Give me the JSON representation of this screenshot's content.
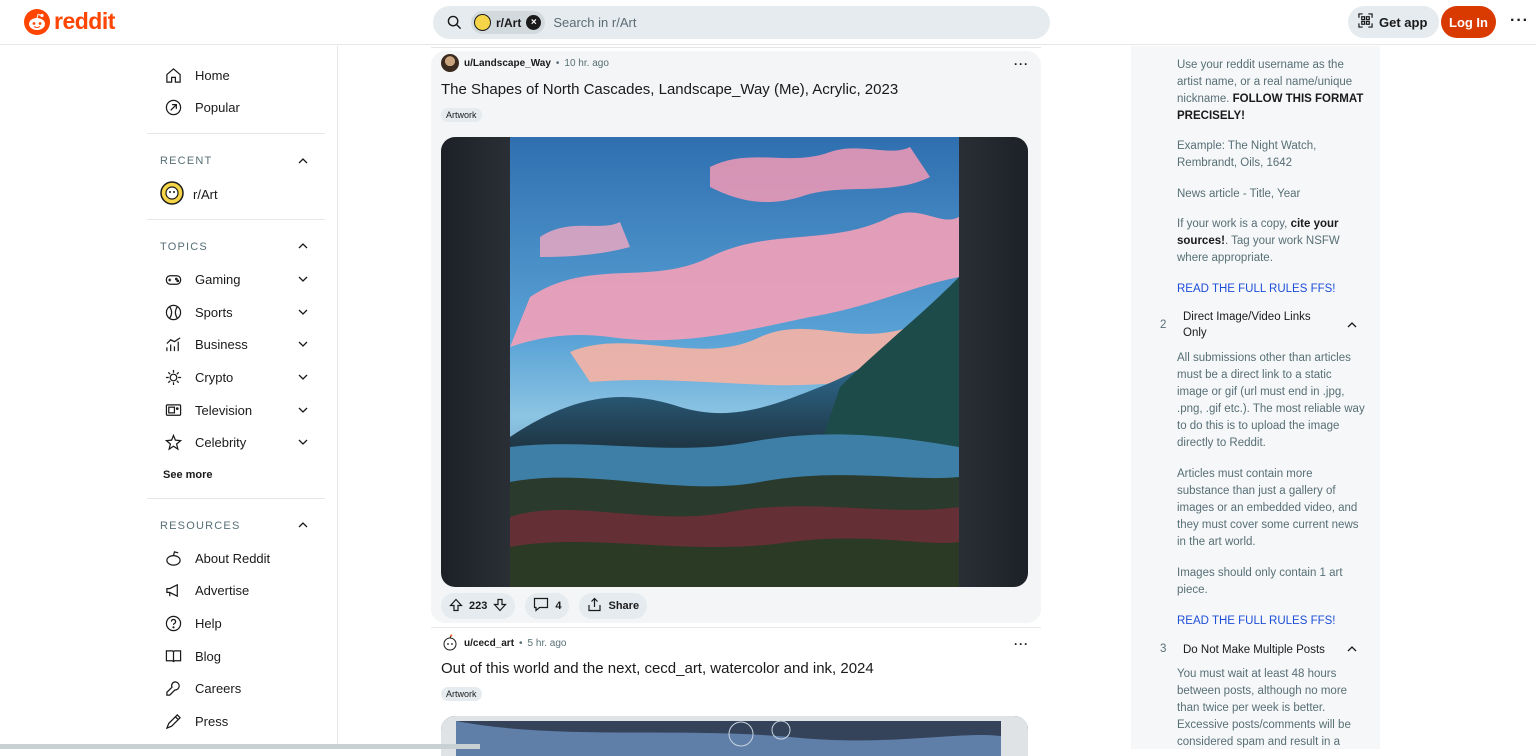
{
  "header": {
    "logo_text": "reddit",
    "search": {
      "community": "r/Art",
      "placeholder": "Search in r/Art"
    },
    "get_app_label": "Get app",
    "login_label": "Log In",
    "more_label": "···"
  },
  "sidebar": {
    "home": "Home",
    "popular": "Popular",
    "recent_title": "RECENT",
    "recent_item": "r/Art",
    "topics_title": "TOPICS",
    "topics": [
      "Gaming",
      "Sports",
      "Business",
      "Crypto",
      "Television",
      "Celebrity"
    ],
    "see_more": "See more",
    "resources_title": "RESOURCES",
    "resources": [
      "About Reddit",
      "Advertise",
      "Help",
      "Blog",
      "Careers",
      "Press"
    ]
  },
  "posts": [
    {
      "user": "u/Landscape_Way",
      "dot": "•",
      "time": "10 hr. ago",
      "title": "The Shapes of North Cascades, Landscape_Way (Me), Acrylic, 2023",
      "flair": "Artwork",
      "upvotes": "223",
      "comments": "4",
      "share": "Share",
      "more": "···"
    },
    {
      "user": "u/cecd_art",
      "dot": "•",
      "time": "5 hr. ago",
      "title": "Out of this world and the next, cecd_art, watercolor and ink, 2024",
      "flair": "Artwork",
      "more": "···"
    }
  ],
  "rules": {
    "p1_plain": "Use your reddit username as the artist name, or a real name/unique nickname.",
    "p1_bold": "FOLLOW THIS FORMAT PRECISELY!",
    "example": "Example: The Night Watch, Rembrandt, Oils, 1642",
    "news": "News article - Title, Year",
    "copy_a": "If your work is a copy,",
    "copy_bold": "cite your sources!",
    "copy_b": ". Tag your work NSFW where appropriate.",
    "read_link_1": "READ THE FULL RULES FFS!",
    "rule2_num": "2",
    "rule2_title": "Direct Image/Video Links Only",
    "rule2_p1": "All submissions other than articles must be a direct link to a static image or gif (url must end in .jpg, .png, .gif etc.). The most reliable way to do this is to upload the image directly to Reddit.",
    "rule2_p2": "Articles must contain more substance than just a gallery of images or an embedded video, and they must cover some current news in the art world.",
    "rule2_p3": "Images should only contain 1 art piece.",
    "read_link_2": "READ THE FULL RULES FFS!",
    "rule3_num": "3",
    "rule3_title": "Do Not Make Multiple Posts",
    "rule3_p1": "You must wait at least 48 hours between posts, although no more than twice per week is better. Excessive posts/comments will be considered spam and result in a"
  },
  "colors": {
    "brand": "#ff4500",
    "login": "#d93a00",
    "link": "#1d4ed8"
  }
}
